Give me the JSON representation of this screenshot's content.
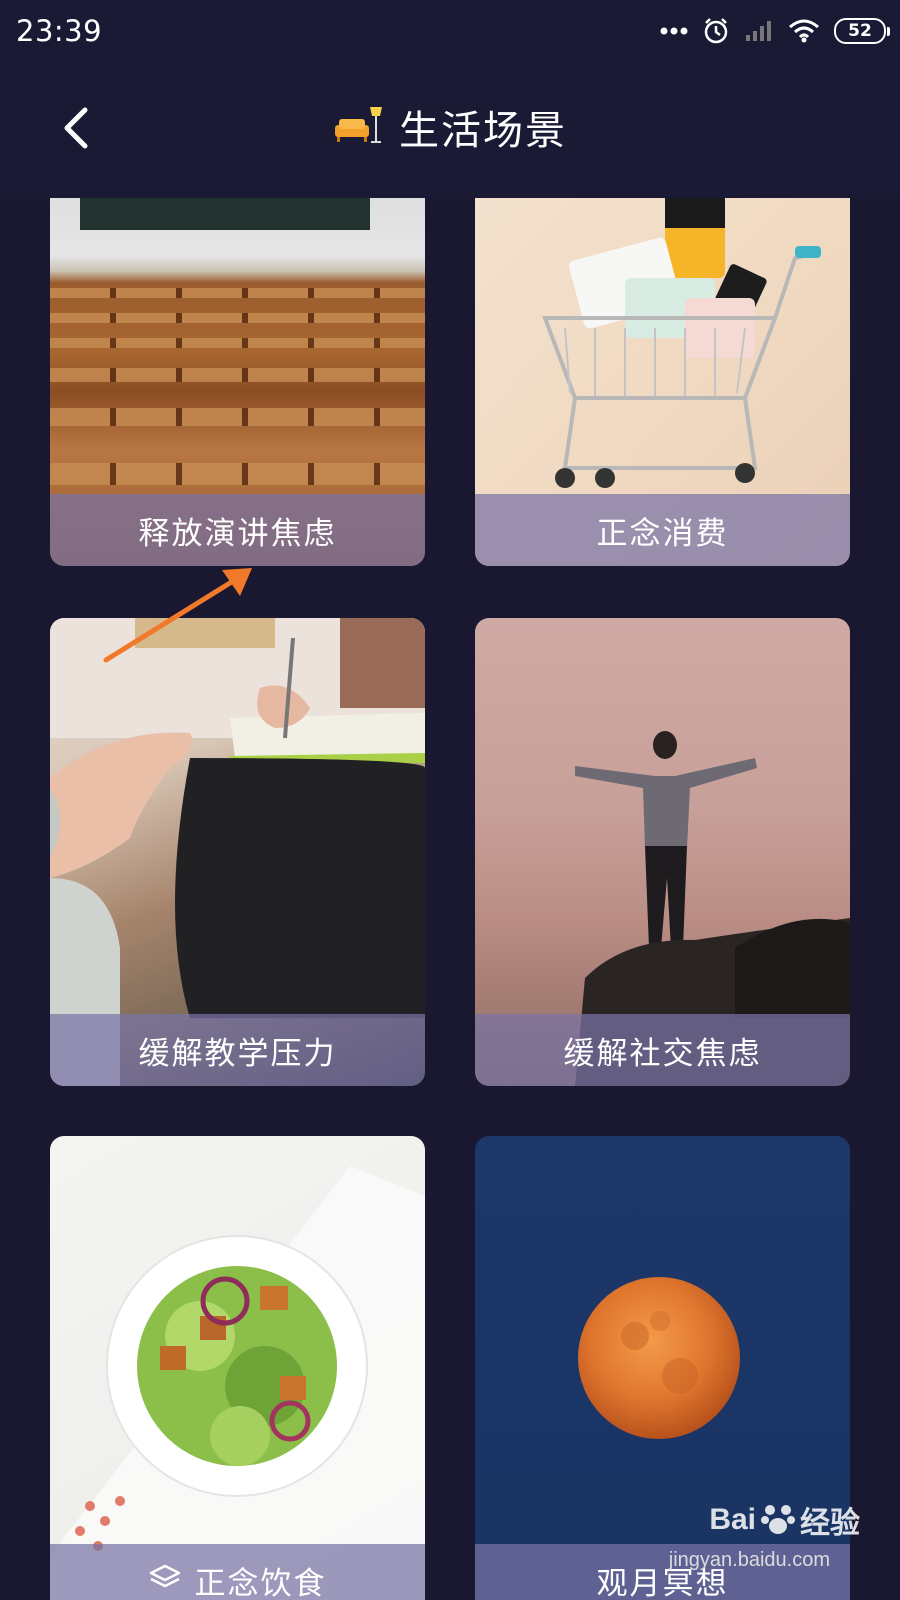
{
  "status_bar": {
    "time": "23:39",
    "battery": "52",
    "icons": [
      "more-dots-icon",
      "alarm-icon",
      "signal-icon",
      "wifi-icon",
      "battery-icon"
    ]
  },
  "header": {
    "back_icon": "chevron-left-icon",
    "title_icon": "sofa-lamp-icon",
    "title": "生活场景"
  },
  "cards": [
    {
      "label": "释放演讲焦虑",
      "image": "auditorium-seats"
    },
    {
      "label": "正念消费",
      "image": "shopping-cart-cosmetics"
    },
    {
      "label": "缓解教学压力",
      "image": "therapy-session-notes"
    },
    {
      "label": "缓解社交焦虑",
      "image": "man-arms-open-on-rock"
    },
    {
      "label": "正念饮食",
      "image": "salad-bowl",
      "icon": "layers-icon"
    },
    {
      "label": "观月冥想",
      "image": "full-moon"
    }
  ],
  "watermark": {
    "brand": "Bai",
    "brand_suffix": "经验",
    "url": "jingyan.baidu.com"
  },
  "colors": {
    "background": "#1a1830",
    "header": "#1b1a35",
    "label_bar": "#7873a5",
    "annotation_arrow": "#f07a2a"
  }
}
